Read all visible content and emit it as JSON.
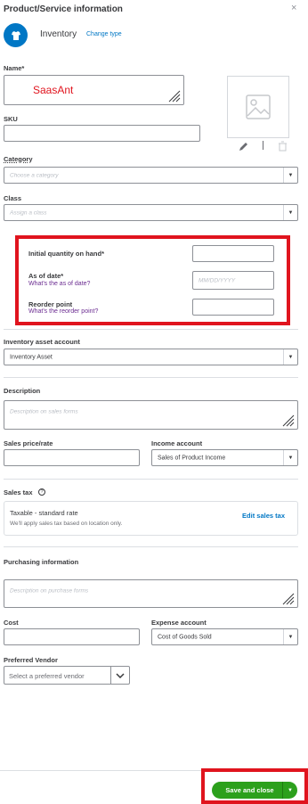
{
  "header": {
    "title": "Product/Service information",
    "close": "×"
  },
  "type": {
    "name": "Inventory",
    "change_label": "Change type"
  },
  "name": {
    "label": "Name*",
    "value": "SaasAnt"
  },
  "sku": {
    "label": "SKU",
    "value": ""
  },
  "category": {
    "label": "Category",
    "placeholder": "Choose a category"
  },
  "class_field": {
    "label": "Class",
    "placeholder": "Assign a class"
  },
  "qty": {
    "label": "Initial quantity on hand*",
    "value": ""
  },
  "as_of": {
    "label": "As of date*",
    "help": "What's the as of date?",
    "placeholder": "MM/DD/YYYY"
  },
  "reorder": {
    "label": "Reorder point",
    "help": "What's the reorder point?",
    "value": ""
  },
  "asset_account": {
    "label": "Inventory asset account",
    "value": "Inventory Asset"
  },
  "description": {
    "label": "Description",
    "placeholder": "Description on sales forms"
  },
  "sales_price": {
    "label": "Sales price/rate",
    "value": ""
  },
  "income_account": {
    "label": "Income account",
    "value": "Sales of Product Income"
  },
  "sales_tax": {
    "label": "Sales tax",
    "rate": "Taxable - standard rate",
    "note": "We'll apply sales tax based on location only.",
    "edit_label": "Edit sales tax"
  },
  "purchasing": {
    "label": "Purchasing information",
    "placeholder": "Description on purchase forms"
  },
  "cost": {
    "label": "Cost",
    "value": ""
  },
  "expense_account": {
    "label": "Expense account",
    "value": "Cost of Goods Sold"
  },
  "vendor": {
    "label": "Preferred Vendor",
    "placeholder": "Select a preferred vendor"
  },
  "footer": {
    "save_label": "Save and close"
  },
  "colors": {
    "accent": "#0077c5",
    "primary": "#2ca01c",
    "highlight": "#e0141e",
    "link": "#6b2c91"
  },
  "icons": [
    "close-icon",
    "inventory-type-icon",
    "image-placeholder-icon",
    "pencil-icon",
    "trash-icon",
    "chevron-down-icon",
    "info-icon"
  ]
}
